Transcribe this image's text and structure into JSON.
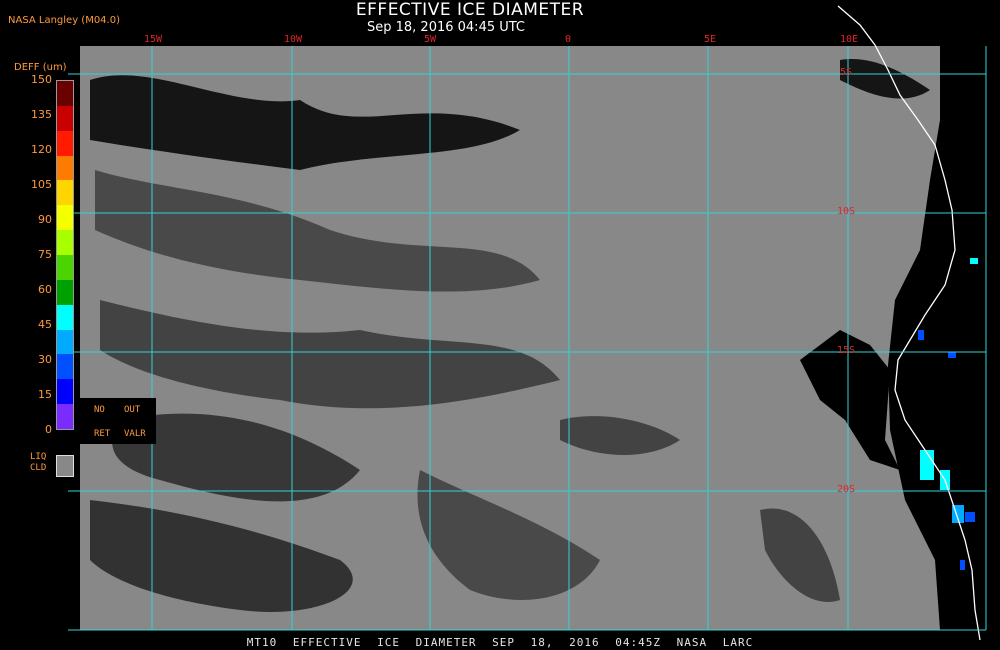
{
  "header": {
    "title": "EFFECTIVE ICE DIAMETER",
    "subtitle": "Sep 18, 2016 04:45 UTC",
    "source": "NASA Langley (M04.0)"
  },
  "legend": {
    "title": "DEFF (um)",
    "ticks": [
      "150",
      "135",
      "120",
      "105",
      "90",
      "75",
      "60",
      "45",
      "30",
      "15",
      "0"
    ],
    "colors": [
      "#6b0000",
      "#c80000",
      "#ff1a00",
      "#ff7a00",
      "#ffd500",
      "#f4ff00",
      "#a7ff00",
      "#4cd400",
      "#00a000",
      "#00ffff",
      "#00aaff",
      "#0050ff",
      "#0000ff",
      "#7a2cff"
    ],
    "codes": {
      "no": "NO",
      "out": "OUT",
      "ret": "RET",
      "valr": "VALR"
    },
    "liquid_cloud": {
      "label_line1": "LIQ",
      "label_line2": "CLD",
      "color": "#888888"
    }
  },
  "grid": {
    "lon_labels": [
      "15W",
      "10W",
      "5W",
      "0",
      "5E",
      "10E"
    ],
    "lat_labels": [
      "5S",
      "10S",
      "15S",
      "20S"
    ],
    "line_color": "#2fd3d6"
  },
  "colors": {
    "cloud_free": "#000000",
    "liquid_cloud": "#888888",
    "coastline": "#ffffff",
    "label": "#ff9a3c",
    "grid_label": "#e0262b"
  },
  "footer": {
    "text": "MT10  EFFECTIVE ICE DIAMETER  SEP 18, 2016 04:45Z  NASA LARC"
  }
}
